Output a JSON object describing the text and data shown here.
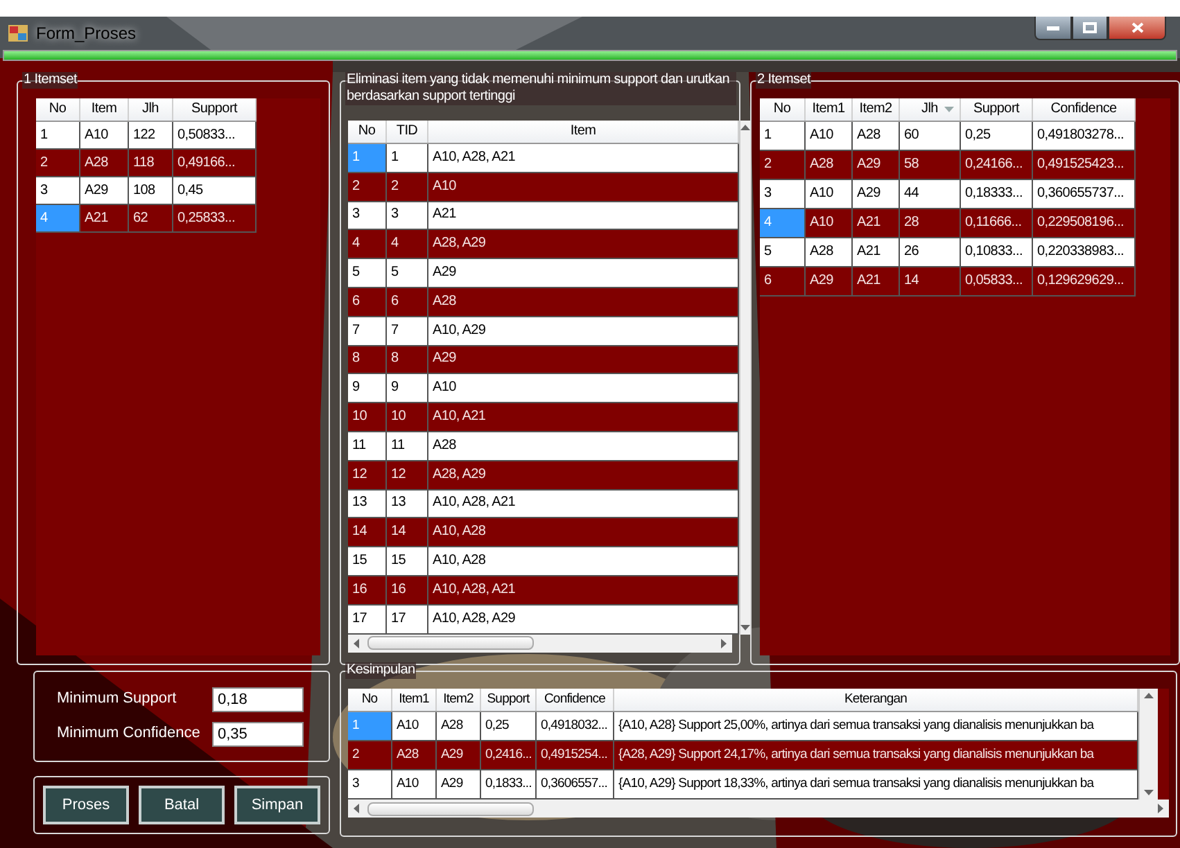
{
  "window": {
    "title": "Form_Proses"
  },
  "progress": {
    "level": 1
  },
  "itemset1": {
    "title": "1 Itemset",
    "columns": [
      "No",
      "Item",
      "Jlh",
      "Support"
    ],
    "rows": [
      {
        "cells": [
          "1",
          "A10",
          "122",
          "0,50833..."
        ],
        "selected": false
      },
      {
        "cells": [
          "2",
          "A28",
          "118",
          "0,49166..."
        ],
        "selected": false
      },
      {
        "cells": [
          "3",
          "A29",
          "108",
          "0,45"
        ],
        "selected": false
      },
      {
        "cells": [
          "4",
          "A21",
          "62",
          "0,25833..."
        ],
        "selected": true
      }
    ]
  },
  "elimination": {
    "title": "Eliminasi item yang tidak memenuhi minimum support dan urutkan berdasarkan support tertinggi",
    "columns": [
      "No",
      "TID",
      "Item"
    ],
    "rows": [
      {
        "cells": [
          "1",
          "1",
          "A10, A28, A21"
        ],
        "selected": true
      },
      {
        "cells": [
          "2",
          "2",
          "A10"
        ],
        "selected": false
      },
      {
        "cells": [
          "3",
          "3",
          "A21"
        ],
        "selected": false
      },
      {
        "cells": [
          "4",
          "4",
          "A28, A29"
        ],
        "selected": false
      },
      {
        "cells": [
          "5",
          "5",
          "A29"
        ],
        "selected": false
      },
      {
        "cells": [
          "6",
          "6",
          "A28"
        ],
        "selected": false
      },
      {
        "cells": [
          "7",
          "7",
          "A10, A29"
        ],
        "selected": false
      },
      {
        "cells": [
          "8",
          "8",
          "A29"
        ],
        "selected": false
      },
      {
        "cells": [
          "9",
          "9",
          "A10"
        ],
        "selected": false
      },
      {
        "cells": [
          "10",
          "10",
          "A10, A21"
        ],
        "selected": false
      },
      {
        "cells": [
          "11",
          "11",
          "A28"
        ],
        "selected": false
      },
      {
        "cells": [
          "12",
          "12",
          "A28, A29"
        ],
        "selected": false
      },
      {
        "cells": [
          "13",
          "13",
          "A10, A28, A21"
        ],
        "selected": false
      },
      {
        "cells": [
          "14",
          "14",
          "A10, A28"
        ],
        "selected": false
      },
      {
        "cells": [
          "15",
          "15",
          "A10, A28"
        ],
        "selected": false
      },
      {
        "cells": [
          "16",
          "16",
          "A10, A28, A21"
        ],
        "selected": false
      },
      {
        "cells": [
          "17",
          "17",
          "A10, A28, A29"
        ],
        "selected": false
      }
    ]
  },
  "itemset2": {
    "title": "2 Itemset",
    "columns": [
      "No",
      "Item1",
      "Item2",
      "Jlh",
      "Support",
      "Confidence"
    ],
    "rows": [
      {
        "cells": [
          "1",
          "A10",
          "A28",
          "60",
          "0,25",
          "0,491803278..."
        ],
        "selected": false
      },
      {
        "cells": [
          "2",
          "A28",
          "A29",
          "58",
          "0,24166...",
          "0,491525423..."
        ],
        "selected": false
      },
      {
        "cells": [
          "3",
          "A10",
          "A29",
          "44",
          "0,18333...",
          "0,360655737..."
        ],
        "selected": false
      },
      {
        "cells": [
          "4",
          "A10",
          "A21",
          "28",
          "0,11666...",
          "0,229508196..."
        ],
        "selected": true
      },
      {
        "cells": [
          "5",
          "A28",
          "A21",
          "26",
          "0,10833...",
          "0,220338983..."
        ],
        "selected": false
      },
      {
        "cells": [
          "6",
          "A29",
          "A21",
          "14",
          "0,05833...",
          "0,129629629..."
        ],
        "selected": false
      }
    ]
  },
  "parameters": [
    {
      "label": "Minimum Support",
      "value": "0,18"
    },
    {
      "label": "Minimum Confidence",
      "value": "0,35"
    }
  ],
  "buttons": [
    "Proses",
    "Batal",
    "Simpan"
  ],
  "conclusion": {
    "title": "Kesimpulan",
    "columns": [
      "No",
      "Item1",
      "Item2",
      "Support",
      "Confidence",
      "Keterangan"
    ],
    "rows": [
      {
        "cells": [
          "1",
          "A10",
          "A28",
          "0,25",
          "0,4918032...",
          "{A10, A28} Support 25,00%, artinya dari semua transaksi yang dianalisis menunjukkan ba"
        ],
        "selected": true
      },
      {
        "cells": [
          "2",
          "A28",
          "A29",
          "0,2416...",
          "0,4915254...",
          "{A28, A29} Support 24,17%, artinya dari semua transaksi yang dianalisis menunjukkan ba"
        ],
        "selected": false
      },
      {
        "cells": [
          "3",
          "A10",
          "A29",
          "0,1833...",
          "0,3606557...",
          "{A10, A29} Support 18,33%, artinya dari semua transaksi yang dianalisis menunjukkan ba"
        ],
        "selected": false
      }
    ]
  }
}
